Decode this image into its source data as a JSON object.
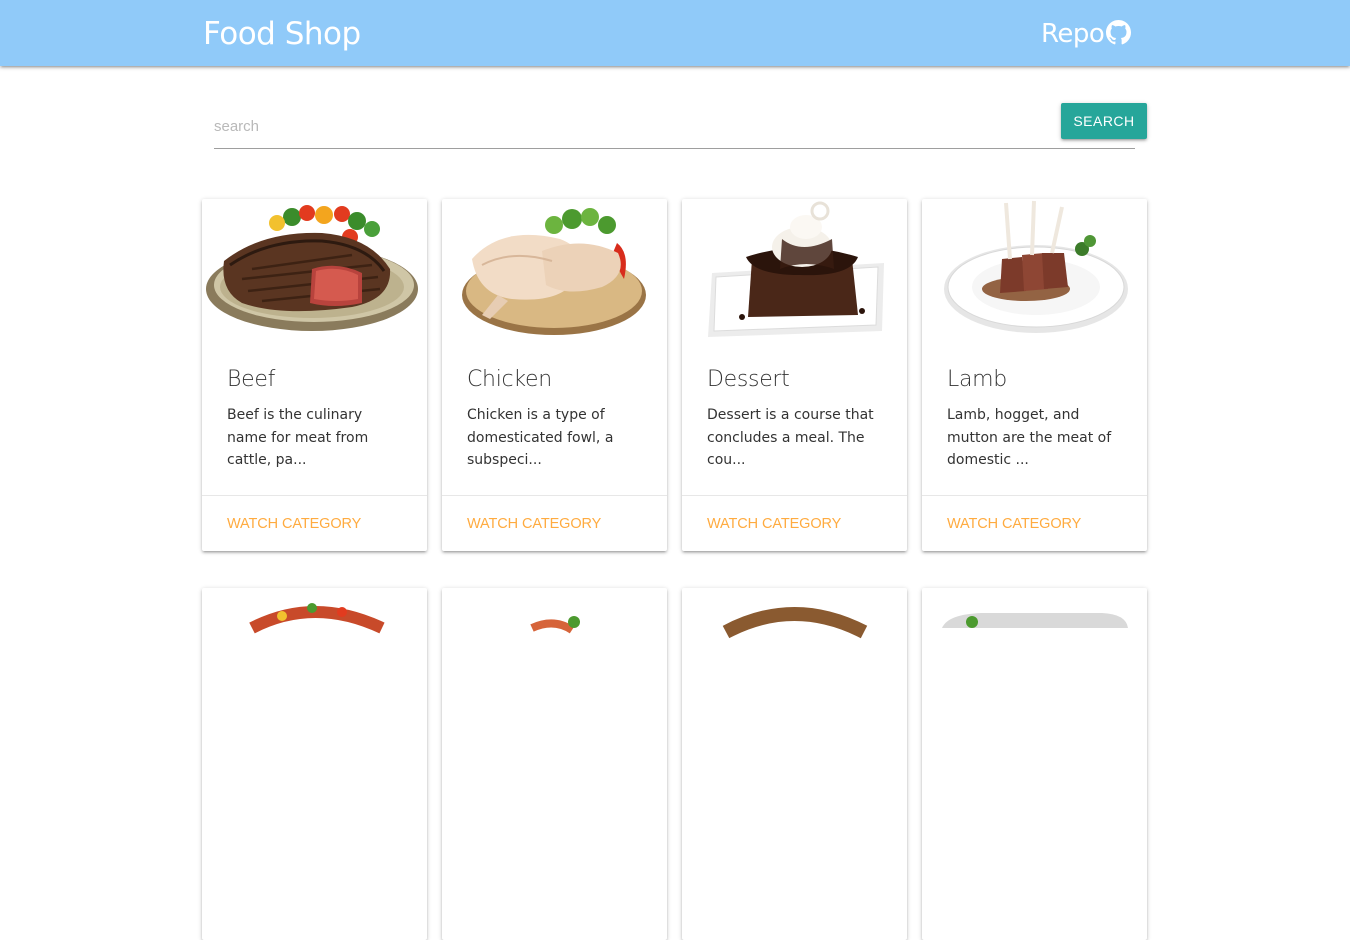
{
  "navbar": {
    "brand": "Food Shop",
    "repo_label": "Repo",
    "repo_icon": "github-icon",
    "background": "#90caf9"
  },
  "search": {
    "placeholder": "search",
    "value": "",
    "button_label": "SEARCH",
    "button_color": "#26a69a"
  },
  "categories": [
    {
      "title": "Beef",
      "description": "Beef is the culinary name for meat from cattle, pa...",
      "action": "WATCH CATEGORY"
    },
    {
      "title": "Chicken",
      "description": "Chicken is a type of domesticated fowl, a subspeci...",
      "action": "WATCH CATEGORY"
    },
    {
      "title": "Dessert",
      "description": "Dessert is a course that concludes a meal. The cou...",
      "action": "WATCH CATEGORY"
    },
    {
      "title": "Lamb",
      "description": "Lamb, hogget, and mutton are the meat of domestic ...",
      "action": "WATCH CATEGORY"
    }
  ],
  "theme": {
    "action_color": "#ffab40"
  }
}
